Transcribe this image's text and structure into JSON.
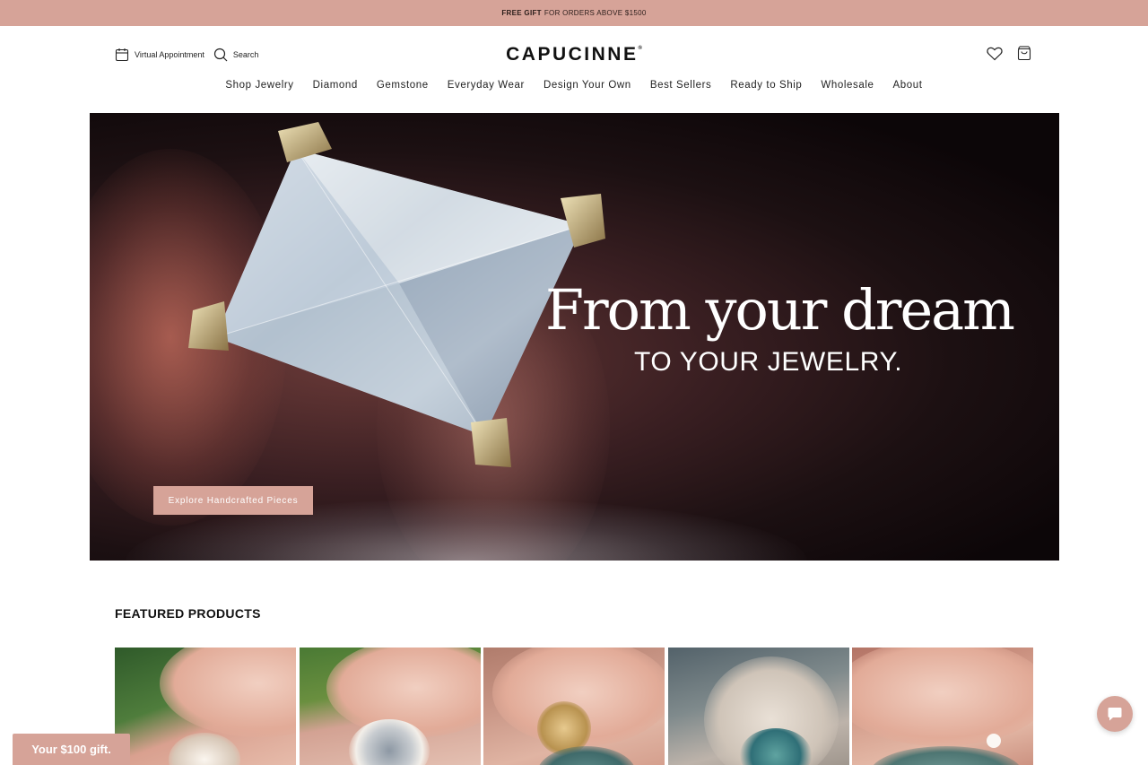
{
  "promo": {
    "highlight": "FREE GIFT",
    "text": "FOR ORDERS ABOVE $1500"
  },
  "header": {
    "virtual_appointment": "Virtual Appointment",
    "search_label": "Search",
    "logo": "CAPUCINNE",
    "logo_mark": "®",
    "icons": {
      "calendar": "calendar-icon",
      "search": "search-icon",
      "wishlist": "heart-icon",
      "cart": "shopping-bag-icon"
    }
  },
  "nav": {
    "items": [
      {
        "label": "Shop Jewelry"
      },
      {
        "label": "Diamond"
      },
      {
        "label": "Gemstone"
      },
      {
        "label": "Everyday Wear"
      },
      {
        "label": "Design Your Own"
      },
      {
        "label": "Best Sellers"
      },
      {
        "label": "Ready to Ship"
      },
      {
        "label": "Wholesale"
      },
      {
        "label": "About"
      }
    ]
  },
  "hero": {
    "title": "From your dream",
    "subtitle": "TO YOUR JEWELRY.",
    "cta": "Explore Handcrafted Pieces"
  },
  "featured": {
    "title": "FEATURED PRODUCTS",
    "products": [
      {
        "name": "product-1"
      },
      {
        "name": "product-2"
      },
      {
        "name": "product-3"
      },
      {
        "name": "product-4"
      },
      {
        "name": "product-5"
      }
    ]
  },
  "gift_tab": {
    "label": "Your $100 gift."
  },
  "chat": {
    "icon": "chat-icon"
  },
  "colors": {
    "accent": "#d6a398",
    "text": "#1a1a1a",
    "hero_bg": "#0c0608"
  }
}
